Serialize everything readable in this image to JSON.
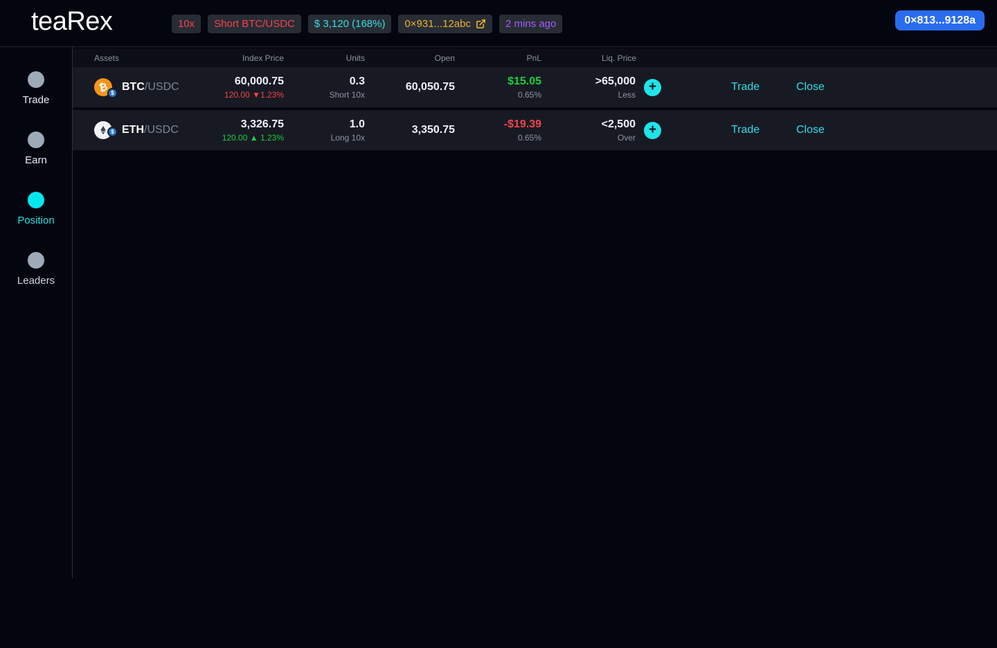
{
  "header": {
    "logo": "teaRex",
    "badges": {
      "leverage": "10x",
      "position": "Short BTC/USDC",
      "value": "$ 3,120 (168%)",
      "contract": "0×931...12abc",
      "time": "2 mins ago"
    },
    "wallet_button": "0×813...9128a"
  },
  "sidebar": {
    "items": [
      {
        "label": "Trade",
        "active": false
      },
      {
        "label": "Earn",
        "active": false
      },
      {
        "label": "Position",
        "active": true
      },
      {
        "label": "Leaders",
        "active": false
      }
    ]
  },
  "table": {
    "columns": {
      "assets": "Assets",
      "index_price": "Index Price",
      "units": "Units",
      "open": "Open",
      "pnl": "PnL",
      "liq_price": "Liq. Price"
    },
    "actions": {
      "trade": "Trade",
      "close": "Close"
    },
    "rows": [
      {
        "base": "BTC",
        "quote": "/USDC",
        "index_price": "60,000.75",
        "index_change": "120.00",
        "index_change_pct": "▼1.23%",
        "index_change_direction": "down",
        "units": "0.3",
        "units_sub": "Short 10x",
        "open": "60,050.75",
        "pnl": "$15.05",
        "pnl_pct": "0.65%",
        "pnl_direction": "positive",
        "liq_price": ">65,000",
        "liq_sub": "Less"
      },
      {
        "base": "ETH",
        "quote": "/USDC",
        "index_price": "3,326.75",
        "index_change": "120.00",
        "index_change_pct": "▲ 1.23%",
        "index_change_direction": "up",
        "units": "1.0",
        "units_sub": "Long 10x",
        "open": "3,350.75",
        "pnl": "-$19.39",
        "pnl_pct": "0.65%",
        "pnl_direction": "negative",
        "liq_price": "<2,500",
        "liq_sub": "Over"
      }
    ]
  },
  "colors": {
    "accent_cyan": "#2bdce6",
    "positive_green": "#17d13c",
    "negative_red": "#f4434b",
    "contract_yellow": "#e7b431",
    "time_purple": "#a55cf6",
    "wallet_blue": "#2a6cf0",
    "row_background": "#181a23",
    "page_background": "#04060f"
  }
}
